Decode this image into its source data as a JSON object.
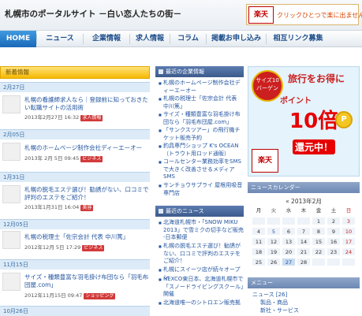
{
  "header": {
    "title": "札幌市のポータルサイト －白い恋人たちの街－",
    "banner_logo": "楽天",
    "banner_text": "クリックひとつで楽に出ませんか？"
  },
  "nav": [
    {
      "label": "HOME"
    },
    {
      "label": "ニュース"
    },
    {
      "label": "企業情報"
    },
    {
      "label": "求人情報"
    },
    {
      "label": "コラム"
    },
    {
      "label": "掲載お申し込み"
    },
    {
      "label": "相互リンク募集"
    }
  ],
  "news": {
    "header": "新着情報",
    "items": [
      {
        "date": "2月27日",
        "title": "札幌の看護師求人なら｜登録前に知っておきたい転職サイトの活用術",
        "meta": "2013年2月27日 16:32",
        "tag": "求人情報",
        "tag_color": "#d23a3a"
      },
      {
        "date": "2月05日",
        "title": "札幌のホームページ制作会社ディーエーオー",
        "meta": "2013年 2月 5日 09:45",
        "tag": "ビジネス",
        "tag_color": "#d23a3a"
      },
      {
        "date": "1月31日",
        "title": "札幌の脱毛エステ選び！勧誘がない、口コミで評判のエステをご紹介！",
        "meta": "2013年1月31日 16:04",
        "tag": "美容",
        "tag_color": "#d23a3a"
      },
      {
        "date": "12月05日",
        "title": "札幌の税理士「佐宗会計 代表 中川篤」",
        "meta": "2012年12月 5日 17:29",
        "tag": "ビジネス",
        "tag_color": "#d23a3a"
      },
      {
        "date": "11月15日",
        "title": "サイズ・種類豊富な羽毛掛け布団なら「羽毛布団屋.com」",
        "meta": "2012年11月15日 09:47",
        "tag": "ショッピング",
        "tag_color": "#d23a3a"
      },
      {
        "date": "10月26日",
        "title": "",
        "meta": "",
        "tag": "",
        "tag_color": "#d23a3a"
      }
    ]
  },
  "companies": {
    "header": "最近の企業情報",
    "items": [
      "札幌のホームページ制作会社ディーエーオー",
      "札幌の税理士「佐宗会計 代表 中川篤」",
      "サイズ・種類豊富な羽毛掛け布団なら「羽毛布団屋.com」",
      "「サンクスツアー」の飛行機チケット販売予約",
      "釣具専門ショップ K's OCEAN（トラウト用ロッド通販）",
      "コールセンター業務効率をSMSで大きく改善させるメディアSMS",
      "サンチョウサプライ 屋根用吸音専門店"
    ]
  },
  "news_links": {
    "header": "最近のニュース",
    "items": [
      "北海道札幌市・「SNOW MIKU 2013」で雪ミクの切手など販売 -日本郵便",
      "札幌の脱毛エステ選び！勧誘がない、口コミで評判のエステをご紹介！",
      "札幌にスイーツ店が続々オープン",
      "NEXCO東日本、北海道札幌市で「スノードライビングスクール」開催",
      "北海道唯一のシトロエン販売拠"
    ]
  },
  "ad": {
    "badge": "サイズ10 バーゲン",
    "line1": "旅行をお得に",
    "line2": "ポイント",
    "line3": "10倍",
    "line4": "還元中！",
    "logo": "楽天",
    "coin": "P"
  },
  "calendar": {
    "header": "ニュースカレンダー",
    "title": "« 2013年2月",
    "weekdays": [
      "月",
      "火",
      "水",
      "木",
      "金",
      "土",
      "日"
    ],
    "rows": [
      [
        "",
        "",
        "",
        "",
        "1",
        "2",
        "3"
      ],
      [
        "4",
        "5",
        "6",
        "7",
        "8",
        "9",
        "10"
      ],
      [
        "11",
        "12",
        "13",
        "14",
        "15",
        "16",
        "17"
      ],
      [
        "18",
        "19",
        "20",
        "21",
        "22",
        "23",
        "24"
      ],
      [
        "25",
        "26",
        "27",
        "28",
        "",
        "",
        ""
      ]
    ]
  },
  "menu": {
    "header": "メニュー",
    "items": [
      "ニュース [26]",
      "製品・商品",
      "新社・サービス"
    ]
  }
}
